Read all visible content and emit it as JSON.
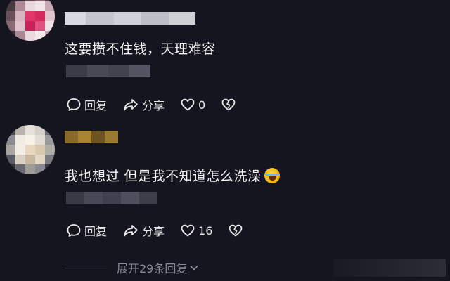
{
  "comments": [
    {
      "text": "这要攒不住钱，天理难容",
      "reply_label": "回复",
      "share_label": "分享",
      "like_count": "0"
    },
    {
      "text": "我也想过  但是我不知道怎么洗澡",
      "reply_label": "回复",
      "share_label": "分享",
      "like_count": "16"
    }
  ],
  "expand_replies_label": "展开29条回复",
  "colors": {
    "background": "#15151f",
    "text": "#f2f2f2",
    "muted": "#8a8a99"
  },
  "icons": [
    "reply-icon",
    "share-icon",
    "heart-icon",
    "dislike-icon",
    "chevron-down-icon",
    "laughing-emoji"
  ]
}
